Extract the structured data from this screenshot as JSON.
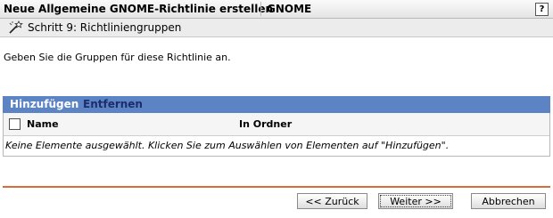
{
  "header": {
    "title": "Neue Allgemeine GNOME-Richtlinie erstellen",
    "platform": "GNOME",
    "help_label": "?",
    "help_icon": "help-icon"
  },
  "step": {
    "icon": "wizard-wand-icon",
    "title": "Schritt 9: Richtliniengruppen"
  },
  "instruction": "Geben Sie die Gruppen für diese Richtlinie an.",
  "toolbar": {
    "add_label": "Hinzufügen",
    "remove_label": "Entfernen"
  },
  "table": {
    "columns": [
      "Name",
      "In Ordner"
    ],
    "empty_message": "Keine Elemente ausgewählt. Klicken Sie zum Auswählen von Elementen auf \"Hinzufügen\"."
  },
  "buttons": {
    "back": "<< Zurück",
    "next": "Weiter >>",
    "cancel": "Abbrechen"
  },
  "colors": {
    "toolbar_bg": "#5c84c5",
    "divider": "#d96b3a"
  }
}
